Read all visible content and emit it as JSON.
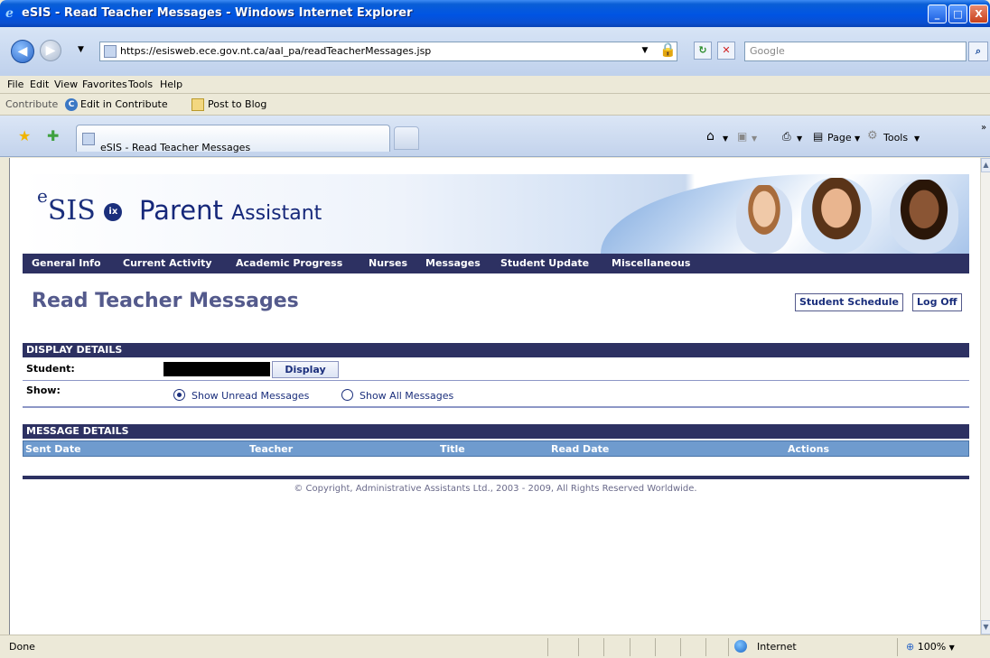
{
  "window": {
    "title": "eSIS - Read Teacher Messages - Windows Internet Explorer",
    "min": "_",
    "max": "□",
    "close": "X"
  },
  "address": {
    "url": "https://esisweb.ece.gov.nt.ca/aal_pa/readTeacherMessages.jsp",
    "search_placeholder": "Google"
  },
  "menu": [
    "File",
    "Edit",
    "View",
    "Favorites",
    "Tools",
    "Help"
  ],
  "contribute": {
    "label": "Contribute",
    "edit": "Edit in Contribute",
    "post": "Post to Blog"
  },
  "tab": {
    "title": "eSIS - Read Teacher Messages"
  },
  "commands": {
    "page": "Page",
    "tools": "Tools"
  },
  "banner": {
    "logo": "SIS",
    "logo_sup": "e",
    "logo_badge": "ix",
    "app_name": "Parent",
    "app_sub": "Assistant"
  },
  "nav": [
    "General Info",
    "Current Activity",
    "Academic Progress",
    "Nurses",
    "Messages",
    "Student Update",
    "Miscellaneous"
  ],
  "page": {
    "title": "Read Teacher Messages",
    "student_schedule": "Student Schedule",
    "log_off": "Log Off"
  },
  "display_details": {
    "header": "DISPLAY DETAILS",
    "student_label": "Student:",
    "display_button": "Display",
    "show_label": "Show:",
    "opt_unread": "Show Unread Messages",
    "opt_all": "Show All Messages"
  },
  "message_details": {
    "header": "MESSAGE DETAILS",
    "columns": [
      "Sent Date",
      "Teacher",
      "Title",
      "Read Date",
      "Actions"
    ]
  },
  "footer": {
    "copyright": "© Copyright, Administrative Assistants Ltd., 2003 - 2009, All Rights Reserved Worldwide."
  },
  "status": {
    "text": "Done",
    "zone": "Internet",
    "zoom": "100%"
  }
}
